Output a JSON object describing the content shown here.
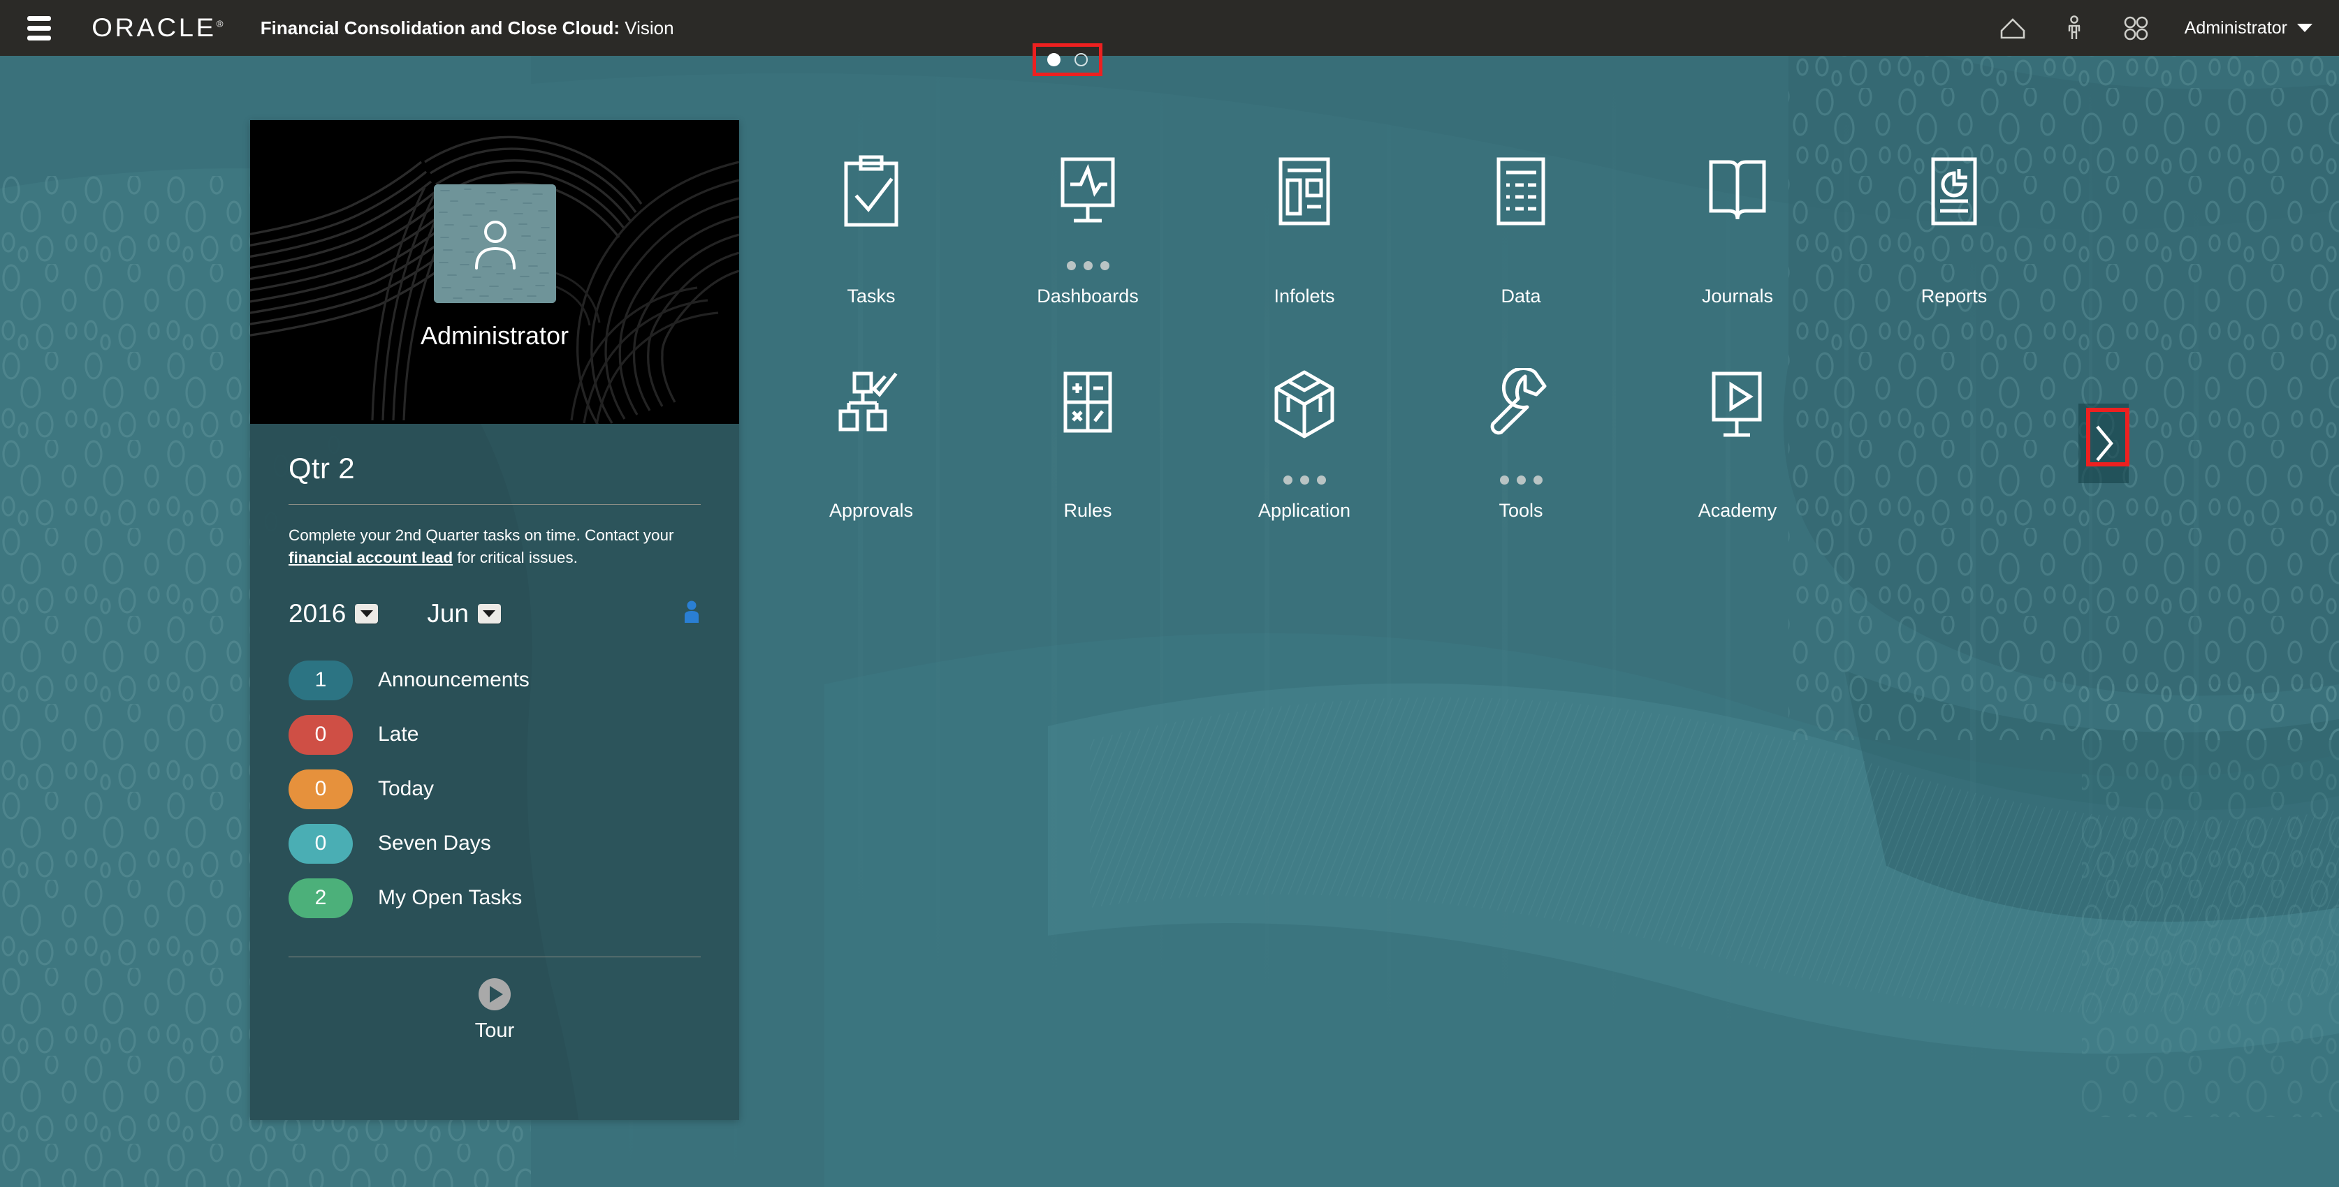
{
  "header": {
    "menu_icon": "hamburger-icon",
    "logo_text": "ORACLE",
    "logo_mark": "®",
    "app_title": "Financial Consolidation and Close Cloud:",
    "app_subtitle": " Vision",
    "icons": [
      {
        "name": "home-icon",
        "label": "Home"
      },
      {
        "name": "accessibility-icon",
        "label": "Accessibility"
      },
      {
        "name": "app-grid-icon",
        "label": "Navigator"
      }
    ],
    "user_menu_label": "Administrator"
  },
  "page_indicator": {
    "dots": [
      {
        "state": "active"
      },
      {
        "state": "inactive"
      }
    ],
    "highlight_color": "#ee2020"
  },
  "user_card": {
    "avatar_name": "Administrator",
    "avatar_icon": "user-avatar-icon",
    "quarter_title": "Qtr 2",
    "description_before": "Complete your 2nd Quarter tasks on time. Contact your ",
    "description_link": "financial account lead",
    "description_after": " for critical issues.",
    "year_value": "2016",
    "month_value": "Jun",
    "assignee_icon": "person-blue-icon",
    "assignee_color": "#2a7fd4",
    "status_items": [
      {
        "count": "1",
        "label": "Announcements",
        "color": "#2c7483"
      },
      {
        "count": "0",
        "label": "Late",
        "color": "#cf4f45"
      },
      {
        "count": "0",
        "label": "Today",
        "color": "#e6913c"
      },
      {
        "count": "0",
        "label": "Seven Days",
        "color": "#4aaeb4"
      },
      {
        "count": "2",
        "label": "My Open Tasks",
        "color": "#4cb07a"
      }
    ],
    "tour_icon": "play-circle-icon",
    "tour_label": "Tour"
  },
  "nav_cards": [
    {
      "label": "Tasks",
      "icon": "clipboard-check-icon",
      "has_dots": false
    },
    {
      "label": "Dashboards",
      "icon": "monitor-pulse-icon",
      "has_dots": true
    },
    {
      "label": "Infolets",
      "icon": "infolet-layout-icon",
      "has_dots": false
    },
    {
      "label": "Data",
      "icon": "data-list-icon",
      "has_dots": false
    },
    {
      "label": "Journals",
      "icon": "open-book-icon",
      "has_dots": false
    },
    {
      "label": "Reports",
      "icon": "report-pie-icon",
      "has_dots": false
    },
    {
      "label": "Approvals",
      "icon": "approvals-hierarchy-icon",
      "has_dots": false
    },
    {
      "label": "Rules",
      "icon": "rules-operators-icon",
      "has_dots": false
    },
    {
      "label": "Application",
      "icon": "cube-icon",
      "has_dots": true
    },
    {
      "label": "Tools",
      "icon": "wrench-icon",
      "has_dots": true
    },
    {
      "label": "Academy",
      "icon": "video-play-icon",
      "has_dots": false
    }
  ],
  "next_page": {
    "icon": "chevron-right-icon",
    "highlight_color": "#ee2020"
  },
  "theme": {
    "header_bg": "#2b2a27",
    "page_bg": "#3a717b",
    "card_body_bg": "#2a5057",
    "card_photo_bg": "#000000",
    "accent_white": "#ffffff"
  }
}
